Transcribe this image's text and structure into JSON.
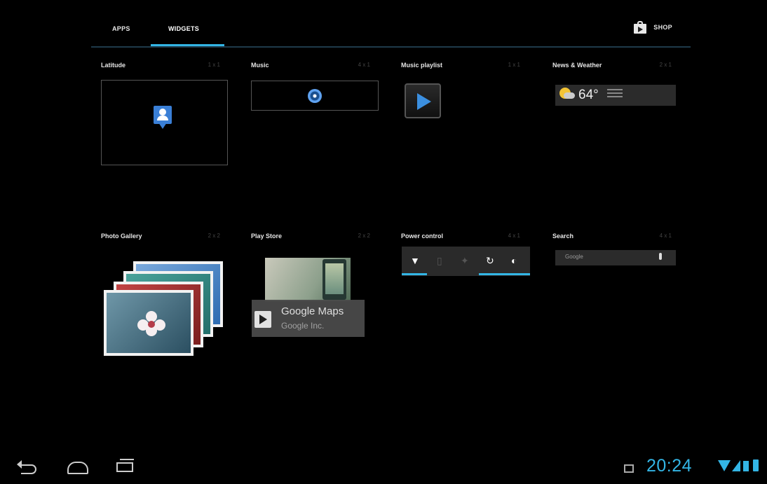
{
  "tabs": [
    {
      "label": "APPS",
      "selected": false
    },
    {
      "label": "WIDGETS",
      "selected": true
    }
  ],
  "shop": {
    "label": "SHOP",
    "icon": "play-store-bag-icon"
  },
  "accent_color": "#33b5e5",
  "widgets": [
    {
      "title": "Latitude",
      "size": "1 x 1"
    },
    {
      "title": "Music",
      "size": "4 x 1"
    },
    {
      "title": "Music playlist",
      "size": "1 x 1"
    },
    {
      "title": "News & Weather",
      "size": "2 x 1"
    },
    {
      "title": "Photo Gallery",
      "size": "2 x 2"
    },
    {
      "title": "Play Store",
      "size": "2 x 2"
    },
    {
      "title": "Power control",
      "size": "4 x 1"
    },
    {
      "title": "Search",
      "size": "4 x 1"
    }
  ],
  "weather": {
    "temperature": "64°"
  },
  "play_store_card": {
    "app_name": "Google Maps",
    "developer": "Google Inc."
  },
  "search_widget": {
    "hint": "Google"
  },
  "status_bar": {
    "time": "20:24"
  }
}
